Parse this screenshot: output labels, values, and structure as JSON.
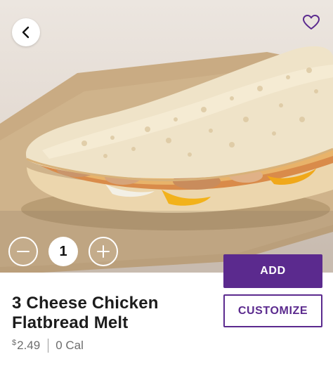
{
  "product": {
    "name_line1": "3 Cheese Chicken",
    "name_line2": "Flatbread Melt",
    "currency_symbol": "$",
    "price": "2.49",
    "calories": "0 Cal"
  },
  "quantity": {
    "value": "1",
    "decrement_icon": "minus-icon",
    "increment_icon": "plus-icon"
  },
  "actions": {
    "add_label": "ADD",
    "customize_label": "CUSTOMIZE"
  },
  "header": {
    "back_icon": "chevron-left-icon",
    "favorite_icon": "heart-outline-icon"
  },
  "colors": {
    "brand_purple": "#5b2a8e",
    "title_text": "#1c1c1c",
    "meta_text": "#6d6d6d"
  }
}
